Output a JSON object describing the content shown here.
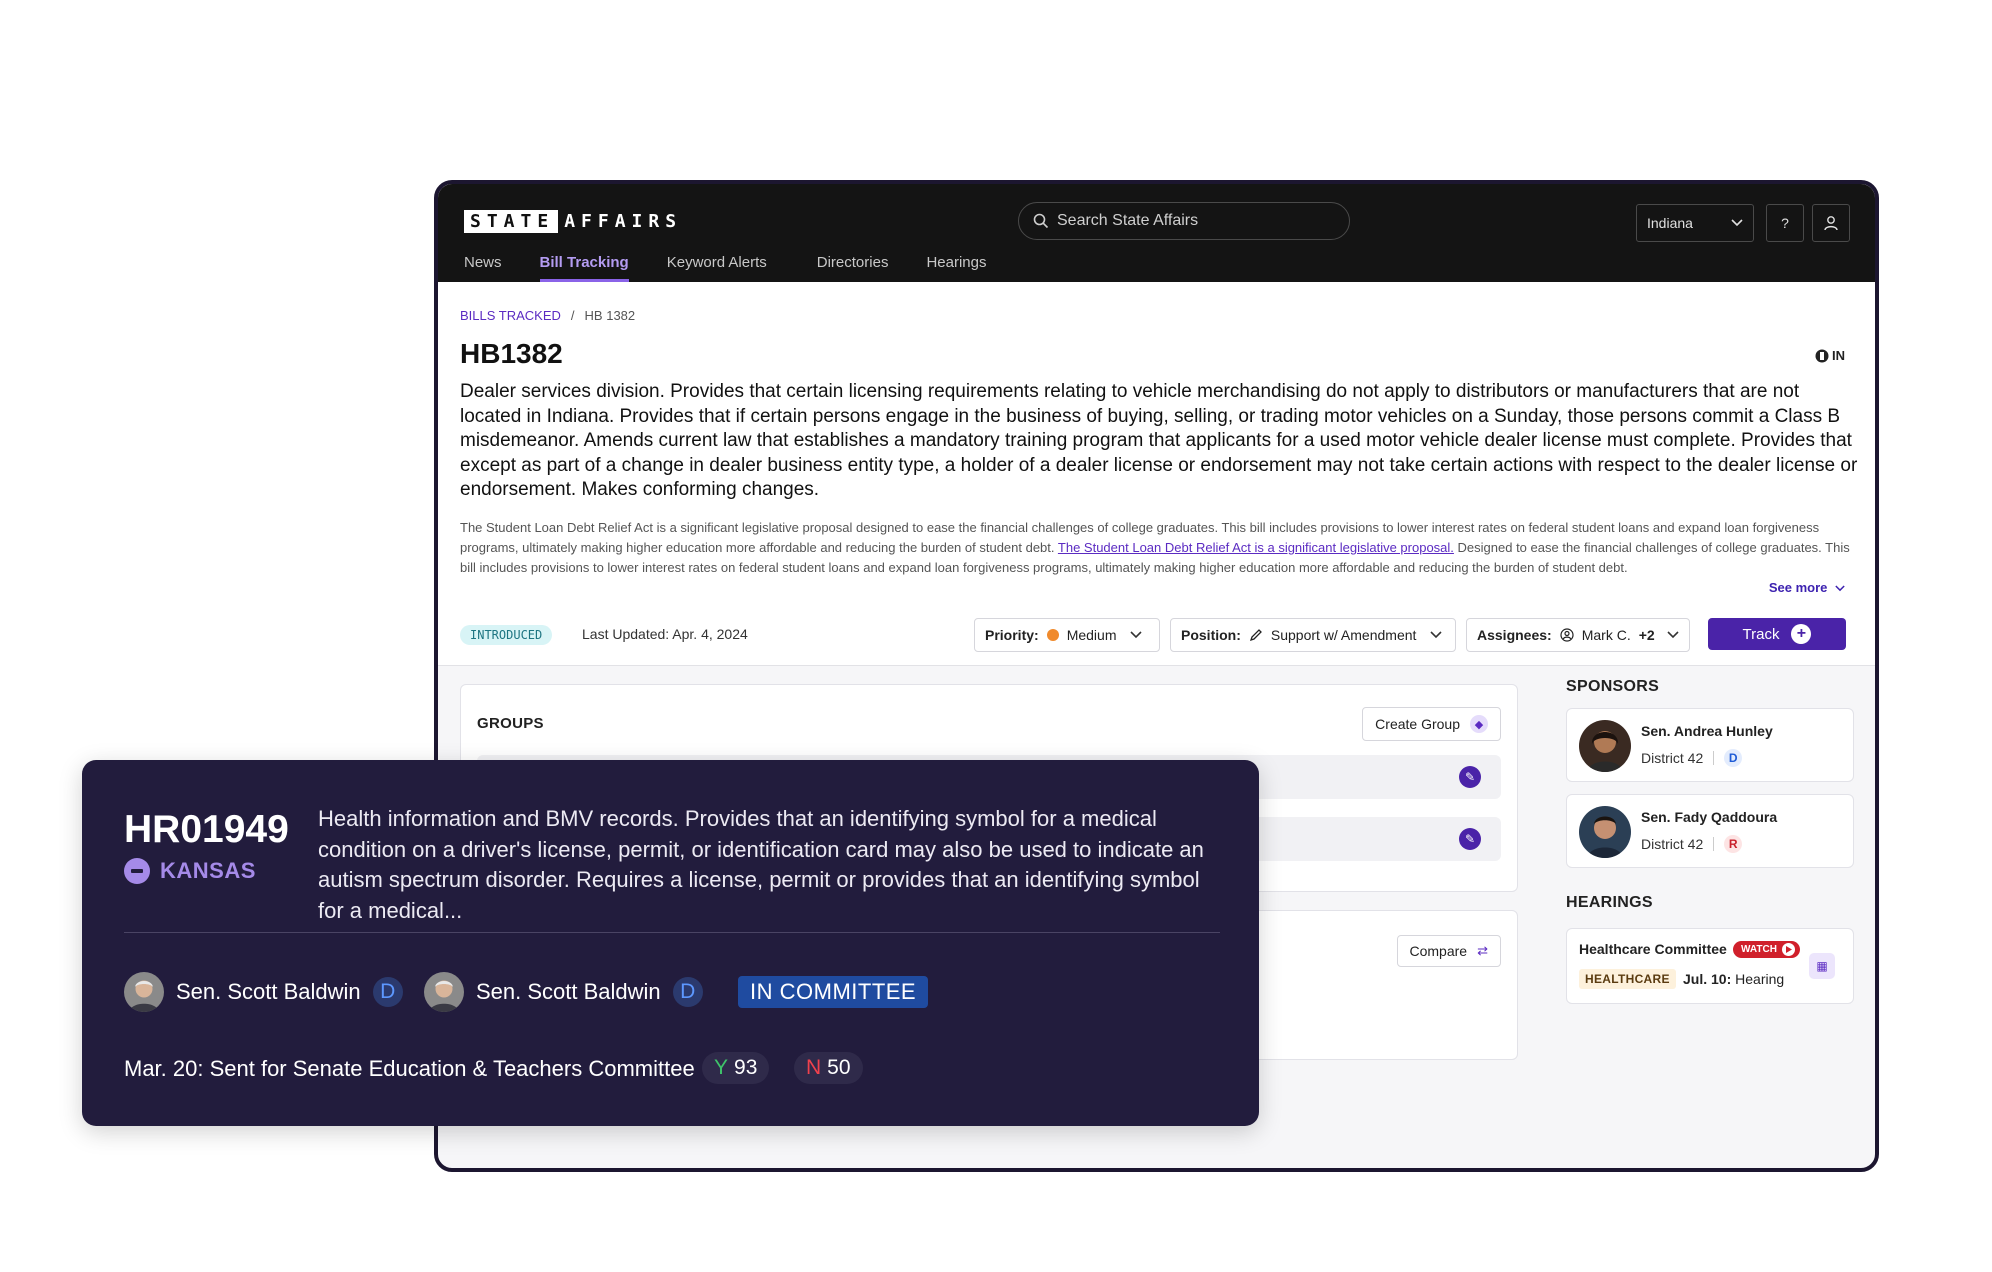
{
  "app": {
    "logo_left": "STATE",
    "logo_right": "AFFAIRS",
    "search_placeholder": "Search State Affairs",
    "state_selector": "Indiana",
    "help_label": "?",
    "nav": [
      "News",
      "Bill Tracking",
      "Keyword Alerts",
      "Directories",
      "Hearings"
    ],
    "active_nav": "Bill Tracking"
  },
  "bill": {
    "breadcrumb": [
      "BILLS TRACKED",
      "HB 1382"
    ],
    "id": "HB1382",
    "state_code": "IN",
    "description": "Dealer services division. Provides that certain licensing requirements relating to vehicle merchandising do not apply to distributors or manufacturers that are not located in Indiana. Provides that if certain persons engage in the business of buying, selling, or trading motor vehicles on a Sunday, those persons commit a Class B misdemeanor. Amends current law that establishes a mandatory training program that applicants for a used motor vehicle dealer license must complete. Provides that except as part of a change in dealer business entity type, a holder of a dealer license or endorsement may not take certain actions with respect to the dealer license or endorsement. Makes conforming changes.",
    "summary_part1": "The Student Loan Debt Relief Act is a significant legislative proposal designed to ease the financial challenges of college graduates. This bill includes provisions to lower interest rates on federal student loans and expand loan forgiveness programs, ultimately making higher education more affordable and reducing the burden of student debt. ",
    "summary_link": "The Student Loan Debt Relief Act is a significant legislative proposal.",
    "summary_part2": " Designed to ease the financial challenges of college graduates. This bill includes provisions to lower interest rates on federal student loans and expand loan forgiveness programs, ultimately making higher education more affordable and reducing the burden of student debt.",
    "see_more": "See more",
    "status": "INTRODUCED",
    "last_updated": "Last Updated: Apr. 4, 2024",
    "priority_label": "Priority:",
    "priority_value": "Medium",
    "position_label": "Position:",
    "position_value": "Support w/ Amendment",
    "assignees_label": "Assignees:",
    "assignees_value": "Mark C.",
    "assignees_extra": "+2",
    "track_label": "Track"
  },
  "groups": {
    "title": "GROUPS",
    "create_label": "Create Group"
  },
  "compare": {
    "label": "Compare"
  },
  "sponsors": {
    "title": "SPONSORS",
    "items": [
      {
        "name": "Sen. Andrea Hunley",
        "district": "District 42",
        "party": "D"
      },
      {
        "name": "Sen. Fady Qaddoura",
        "district": "District 42",
        "party": "R"
      }
    ]
  },
  "hearings": {
    "title": "HEARINGS",
    "committee": "Healthcare Committee",
    "watch": "WATCH",
    "tag": "HEALTHCARE",
    "date_strong": "Jul. 10:",
    "date_rest": " Hearing"
  },
  "overlay": {
    "bill_id": "HR01949",
    "state": "KANSAS",
    "description": "Health information and BMV records. Provides that an identifying symbol for a medical condition on a driver's license, permit, or identification card may also be used to indicate an autism spectrum disorder. Requires a license, permit or provides that an identifying symbol for a medical...",
    "sponsors": [
      {
        "name": "Sen. Scott Baldwin",
        "party": "D"
      },
      {
        "name": "Sen. Scott Baldwin",
        "party": "D"
      }
    ],
    "status": "IN COMMITTEE",
    "last_action": "Mar. 20:  Sent for Senate Education & Teachers Committee",
    "yes_label": "Y",
    "yes_votes": "93",
    "no_label": "N",
    "no_votes": "50"
  },
  "colors": {
    "accent": "#4a23a8",
    "overlay_bg": "#221c3d",
    "topbar_bg": "#141414"
  }
}
